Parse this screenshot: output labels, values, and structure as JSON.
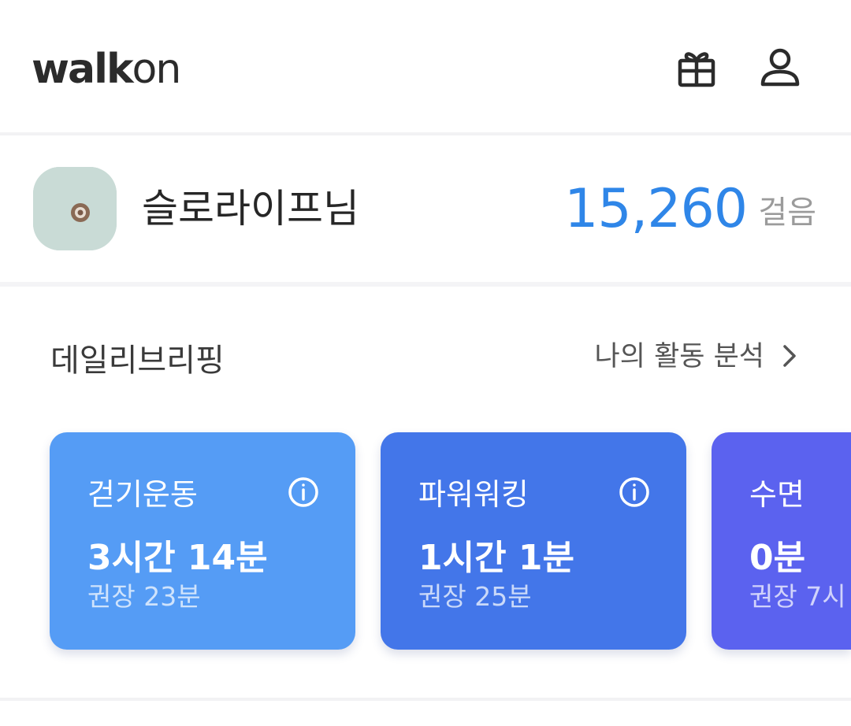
{
  "header": {
    "logo_bold": "walk",
    "logo_light": "on",
    "gift_icon": "gift-icon",
    "profile_icon": "user-icon"
  },
  "profile": {
    "username": "슬로라이프님",
    "steps": "15,260",
    "steps_unit": "걸음"
  },
  "briefing": {
    "title": "데일리브리핑",
    "link": "나의 활동 분석",
    "cards": [
      {
        "title": "걷기운동",
        "value": "3시간 14분",
        "recommend": "권장 23분",
        "color": "#559cf5"
      },
      {
        "title": "파워워킹",
        "value": "1시간 1분",
        "recommend": "권장 25분",
        "color": "#4376e9"
      },
      {
        "title": "수면",
        "value": "0분",
        "recommend": "권장 7시",
        "color": "#5b62ef"
      }
    ]
  },
  "colors": {
    "accent": "#2f86e8"
  }
}
